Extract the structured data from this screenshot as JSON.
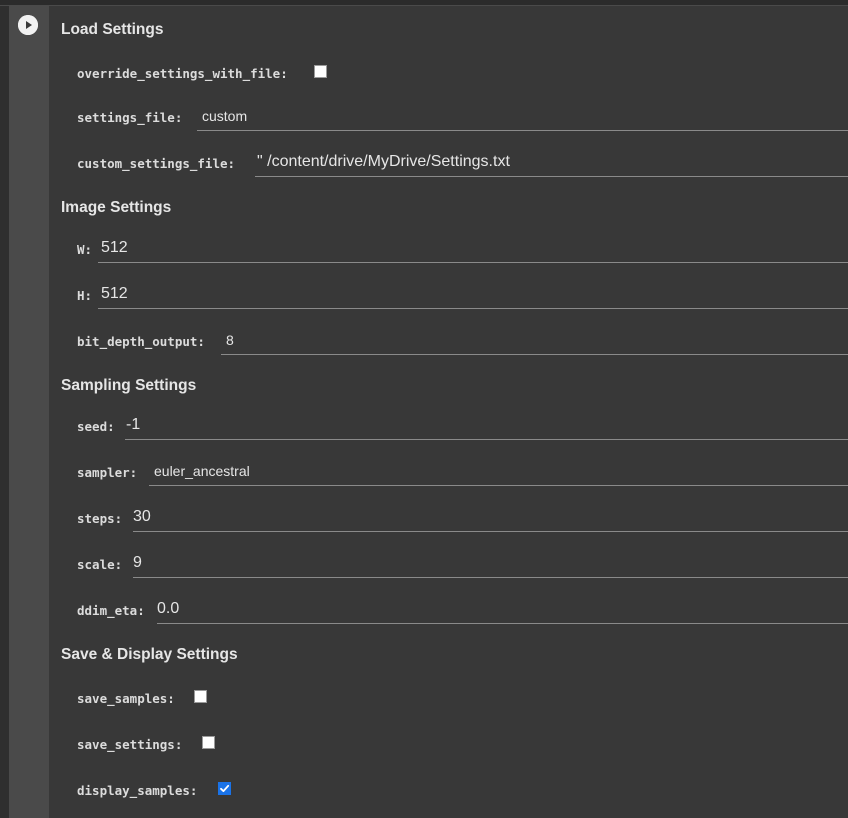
{
  "run_button": {
    "icon": "play-icon"
  },
  "sections": [
    {
      "title": "Load Settings"
    },
    {
      "title": "Image Settings"
    },
    {
      "title": "Sampling Settings"
    },
    {
      "title": "Save & Display Settings"
    }
  ],
  "fields": {
    "override_settings_with_file": {
      "label": "override_settings_with_file:",
      "checked": false
    },
    "settings_file": {
      "label": "settings_file:",
      "value": "custom"
    },
    "custom_settings_file": {
      "label": "custom_settings_file:",
      "value": "\" /content/drive/MyDrive/Settings.txt"
    },
    "W": {
      "label": "W:",
      "value": "512"
    },
    "H": {
      "label": "H:",
      "value": "512"
    },
    "bit_depth_output": {
      "label": "bit_depth_output:",
      "value": "8"
    },
    "seed": {
      "label": "seed:",
      "value": "-1"
    },
    "sampler": {
      "label": "sampler:",
      "value": "euler_ancestral"
    },
    "steps": {
      "label": "steps:",
      "value": "30"
    },
    "scale": {
      "label": "scale:",
      "value": "9"
    },
    "ddim_eta": {
      "label": "ddim_eta:",
      "value": "0.0"
    },
    "save_samples": {
      "label": "save_samples:",
      "checked": false
    },
    "save_settings": {
      "label": "save_settings:",
      "checked": false
    },
    "display_samples": {
      "label": "display_samples:",
      "checked": true
    }
  },
  "colors": {
    "background": "#383838",
    "gutter": "#4a4a4a",
    "checkbox_checked": "#1a73e8"
  }
}
